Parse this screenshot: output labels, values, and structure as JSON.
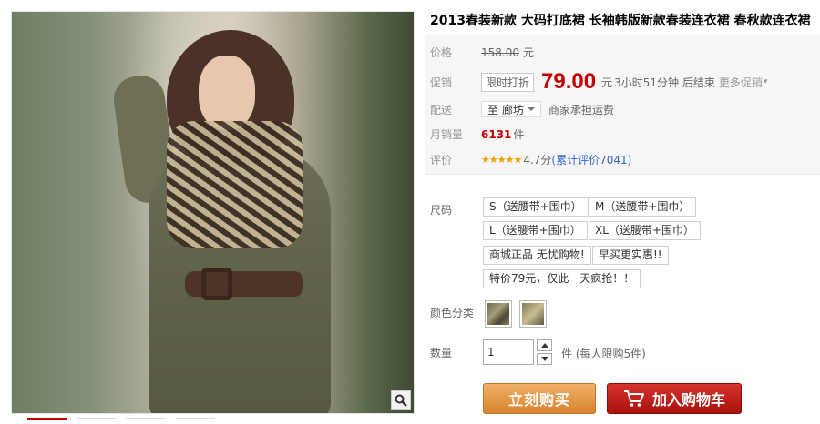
{
  "product": {
    "title": "2013春装新款 大码打底裙 长袖韩版新款春装连衣裙 春秋款连衣裙"
  },
  "pricing": {
    "price_label": "价格",
    "original_price": "158.00",
    "currency_unit": "元",
    "promo_label": "促销",
    "promo_tag": "限时打折",
    "promo_price": "79.00",
    "promo_unit": "元",
    "countdown": "3小时51分钟 后结束",
    "more_promos": "更多促销"
  },
  "shipping": {
    "label": "配送",
    "to_prefix": "至",
    "destination": "廊坊",
    "fee_text": "商家承担运费"
  },
  "sales": {
    "label": "月销量",
    "count": "6131",
    "unit": "件"
  },
  "rating": {
    "label": "评价",
    "stars_glyph": "★★★★★",
    "score_text": "4.7分",
    "reviews_text": "(累计评价7041)",
    "score": 4.7
  },
  "size": {
    "label": "尺码",
    "options": [
      "S（送腰带+围巾）",
      "M（送腰带+围巾）",
      "L（送腰带+围巾）",
      "XL（送腰带+围巾）",
      "商城正品 无忧购物!",
      "早买更实惠!!",
      "特价79元，仅此一天疯抢！！"
    ]
  },
  "color": {
    "label": "颜色分类",
    "swatches": [
      "swatch-1",
      "swatch-2"
    ]
  },
  "quantity": {
    "label": "数量",
    "value": "1",
    "limit_text": "件 (每人限购5件)"
  },
  "actions": {
    "buy_now": "立刻购买",
    "add_to_cart": "加入购物车"
  },
  "icons": {
    "zoom": "magnifier-icon",
    "cart": "shopping-cart-icon",
    "dropdown": "caret-down-icon",
    "up": "arrow-up-icon",
    "down": "arrow-down-icon"
  },
  "colors": {
    "accent_red": "#c40000",
    "buy_orange": "#d8832e",
    "cart_red": "#a9110b",
    "star": "#f0a000",
    "link_blue": "#3366cc"
  }
}
